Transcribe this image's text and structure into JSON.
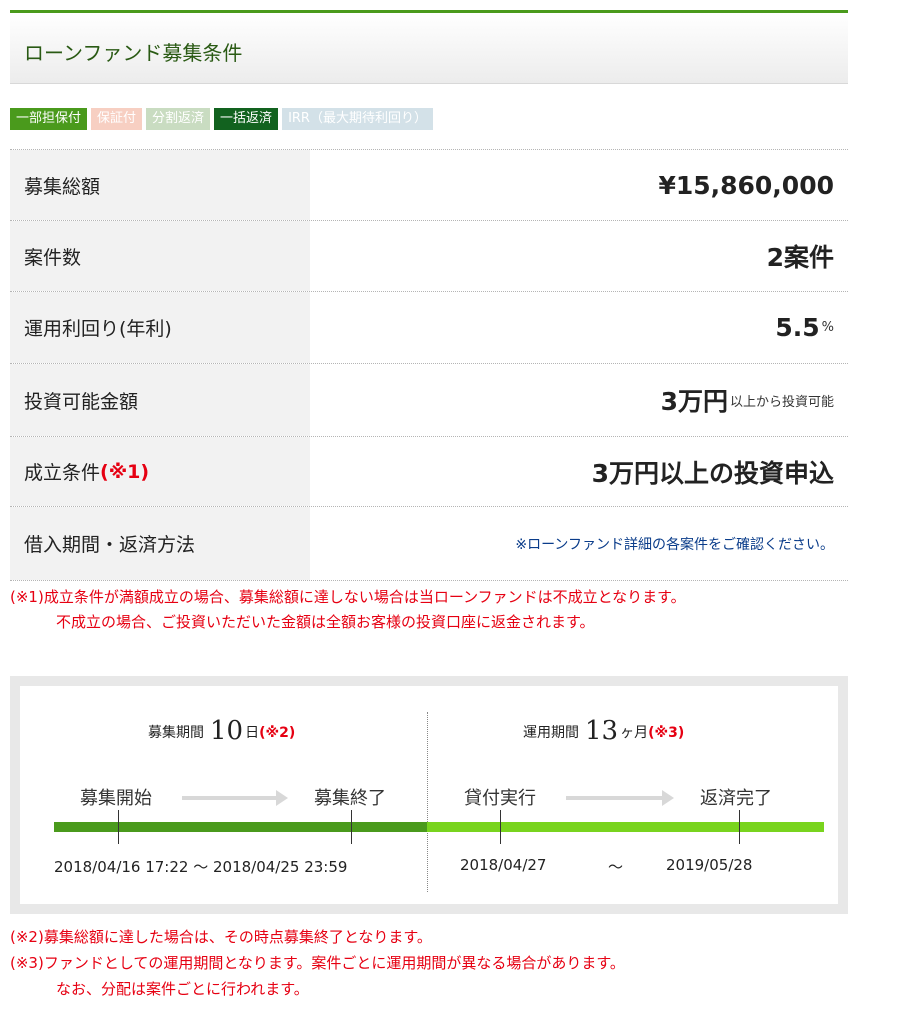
{
  "header": {
    "title": "ローンファンド募集条件"
  },
  "tags": [
    {
      "label": "一部担保付",
      "bg": "#4a9a1c"
    },
    {
      "label": "保証付",
      "bg": "#f7cfc2"
    },
    {
      "label": "分割返済",
      "bg": "#c9dcc1"
    },
    {
      "label": "一括返済",
      "bg": "#12621f"
    },
    {
      "label": "IRR（最大期待利回り）",
      "bg": "#d3e1e8"
    }
  ],
  "rows": {
    "total": {
      "label": "募集総額",
      "value": "¥15,860,000"
    },
    "count": {
      "label": "案件数",
      "value": "2案件"
    },
    "yield": {
      "label": "運用利回り(年利)",
      "value": "5.5",
      "unit": "%"
    },
    "min_invest": {
      "label": "投資可能金額",
      "value": "3万円",
      "suffix": "以上から投資可能"
    },
    "condition": {
      "label": "成立条件",
      "mark": "(※1)",
      "value": "3万円以上の投資申込"
    },
    "period": {
      "label": "借入期間・返済方法",
      "value": "※ローンファンド詳細の各案件をご確認ください。"
    }
  },
  "note1": {
    "line1": "(※1)成立条件が満額成立の場合、募集総額に達しない場合は当ローンファンドは不成立となります。",
    "line2": "不成立の場合、ご投資いただいた金額は全額お客様の投資口座に返金されます。"
  },
  "timeline": {
    "recruit": {
      "label": "募集期間",
      "num": "10",
      "unit": "日",
      "mark": "(※2)"
    },
    "operation": {
      "label": "運用期間",
      "num": "13",
      "unit": "ヶ月",
      "mark": "(※3)"
    },
    "steps": {
      "start": "募集開始",
      "end": "募集終了",
      "loan": "貸付実行",
      "repay": "返済完了"
    },
    "dates": {
      "recruit_range": "2018/04/16 17:22 〜 2018/04/25 23:59",
      "loan_date": "2018/04/27",
      "tilde": "〜",
      "repay_date": "2019/05/28"
    }
  },
  "note2": {
    "line1": "(※2)募集総額に達した場合は、その時点募集終了となります。",
    "line2": "(※3)ファンドとしての運用期間となります。案件ごとに運用期間が異なる場合があります。",
    "line3": "なお、分配は案件ごとに行われます。"
  }
}
